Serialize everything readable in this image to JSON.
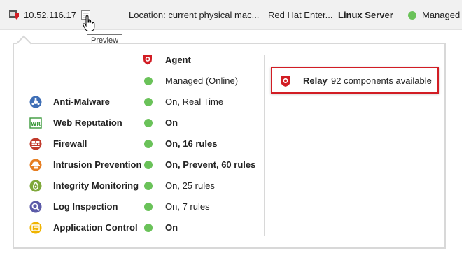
{
  "computer_row": {
    "host": "10.52.116.17",
    "location": "Location: current physical mac...",
    "platform": "Red Hat Enter...",
    "description": "Linux Server",
    "status": "Managed"
  },
  "tooltip": {
    "text": "Preview"
  },
  "preview": {
    "agent_header": "Agent",
    "agent_status": "Managed (Online)",
    "modules": [
      {
        "name": "Anti-Malware",
        "status": "On, Real Time",
        "icon": "anti-malware-icon",
        "bold": false
      },
      {
        "name": "Web Reputation",
        "status": "On",
        "icon": "web-reputation-icon",
        "bold": true
      },
      {
        "name": "Firewall",
        "status": "On, 16 rules",
        "icon": "firewall-icon",
        "bold": true
      },
      {
        "name": "Intrusion Prevention",
        "status": "On, Prevent, 60 rules",
        "icon": "intrusion-prevention-icon",
        "bold": true
      },
      {
        "name": "Integrity Monitoring",
        "status": "On, 25 rules",
        "icon": "integrity-monitoring-icon",
        "bold": false
      },
      {
        "name": "Log Inspection",
        "status": "On, 7 rules",
        "icon": "log-inspection-icon",
        "bold": false
      },
      {
        "name": "Application Control",
        "status": "On",
        "icon": "application-control-icon",
        "bold": true
      }
    ],
    "relay": {
      "label": "Relay",
      "text": "92 components available"
    }
  },
  "colors": {
    "status_green": "#6ac259",
    "brand_red": "#d21d24",
    "highlight_border": "#d21d24"
  }
}
